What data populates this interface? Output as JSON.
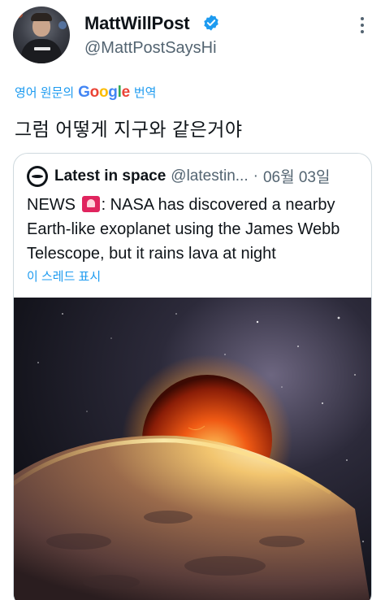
{
  "author": {
    "display_name": "MattWillPost",
    "handle": "@MattPostSaysHi"
  },
  "translate": {
    "prefix": "영어 원문의",
    "brand": [
      "G",
      "o",
      "o",
      "g",
      "l",
      "e"
    ],
    "suffix": "번역"
  },
  "tweet": {
    "text": "그럼 어떻게 지구와 같은거야"
  },
  "quoted": {
    "display_name": "Latest in space",
    "handle": "@latestin...",
    "separator": "·",
    "date": "06월 03일",
    "text_before_icon": "NEWS",
    "text_after_icon": ": NASA has discovered a nearby Earth-like exoplanet using the James Webb Telescope, but it rains lava at night",
    "show_thread": "이 스레드 표시",
    "image_alt_icon": "space-planets-image"
  },
  "colors": {
    "link_blue": "#1d9bf0",
    "secondary_text": "#536471",
    "verified_blue": "#1d9bf0",
    "siren_red": "#e0245e"
  }
}
